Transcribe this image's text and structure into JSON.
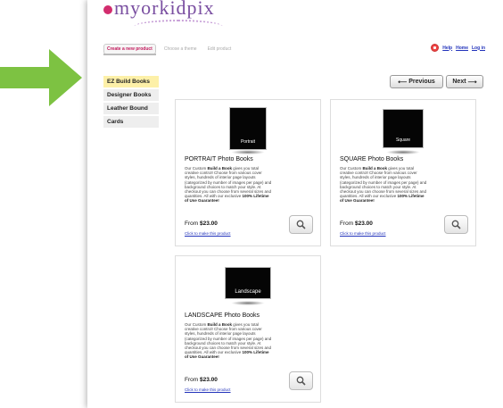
{
  "logo": {
    "text": "myorkidpix"
  },
  "tabs": [
    {
      "label": "Create a new product"
    },
    {
      "label": "Choose a theme"
    },
    {
      "label": "Edit product"
    }
  ],
  "top_links": {
    "help": "Help",
    "home": "Home",
    "login": "Log in"
  },
  "sidebar": {
    "items": [
      {
        "label": "EZ Build Books",
        "active": true
      },
      {
        "label": "Designer Books"
      },
      {
        "label": "Leather Bound"
      },
      {
        "label": "Cards"
      }
    ]
  },
  "nav": {
    "previous": "Previous",
    "next": "Next"
  },
  "products": [
    {
      "thumb_label": "Portrait",
      "title": "PORTRAIT Photo Books",
      "desc_1": "Our Custom ",
      "desc_bold": "Build a Book",
      "desc_2": " gives you total creative control! Choose from various cover styles, hundreds of interior page layouts (categorized by number of images per page) and background choices to match your style. At checkout you can choose from several sizes and quantities. All with our exclusive ",
      "desc_bold2": "100% Lifetime of Use Guarantee!",
      "price_prefix": "From ",
      "price": "$23.00",
      "link": "Click to make this product"
    },
    {
      "thumb_label": "Square",
      "title": "SQUARE Photo Books",
      "desc_1": "Our Custom ",
      "desc_bold": "Build a Book",
      "desc_2": " gives you total creative control! Choose from various cover styles, hundreds of interior page layouts (categorized by number of images per page) and background choices to match your style. At checkout you can choose from several sizes and quantities. All with our exclusive ",
      "desc_bold2": "100% Lifetime of Use Guarantee!",
      "price_prefix": "From ",
      "price": "$23.00",
      "link": "Click to make this product"
    },
    {
      "thumb_label": "Landscape",
      "title": "LANDSCAPE Photo Books",
      "desc_1": "Our Custom ",
      "desc_bold": "Build a Book",
      "desc_2": " gives you total creative control! Choose from various cover styles, hundreds of interior page layouts (categorized by number of images per page) and background choices to match your style. At checkout you can choose from several sizes and quantities. All with our exclusive ",
      "desc_bold2": "100% Lifetime of Use Guarantee!",
      "price_prefix": "From ",
      "price": "$23.00",
      "link": "Click to make this product"
    }
  ],
  "colors": {
    "arrow": "#7dc242",
    "active_side": "#fdf0a8",
    "link": "#2233bb",
    "tab_active": "#c2185b"
  },
  "icons": {
    "arrow": "green-right-arrow-icon",
    "help": "help-lifebuoy-icon",
    "zoom": "magnifier-icon",
    "prev": "arrow-left-icon",
    "next": "arrow-right-icon"
  }
}
